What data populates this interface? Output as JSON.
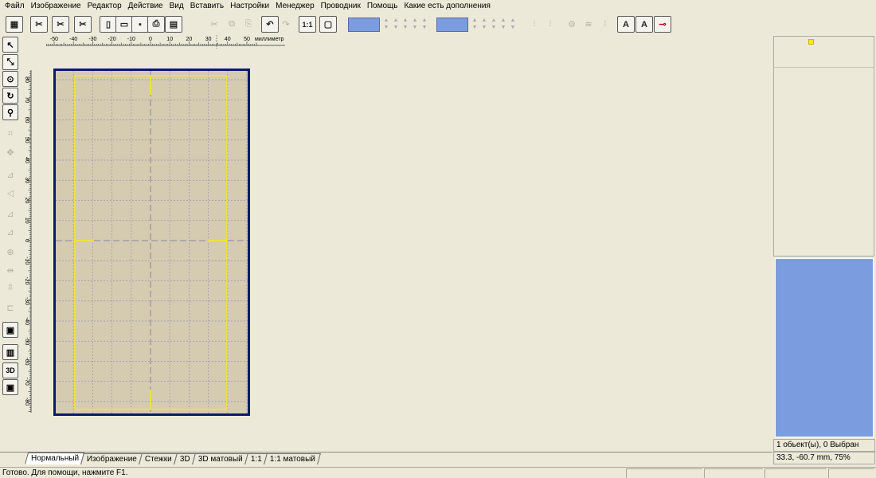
{
  "menu": [
    "Файл",
    "Изображение",
    "Редактор",
    "Действие",
    "Вид",
    "Вставить",
    "Настройки",
    "Менеджер",
    "Проводник",
    "Помощь",
    "Какие есть дополнения"
  ],
  "toolbar": {
    "buttons": [
      {
        "name": "open-design-button",
        "glyph": "▦",
        "enabled": true
      },
      {
        "name": "digitize-button",
        "glyph": "✂",
        "enabled": true
      },
      {
        "name": "digitize-photo-button",
        "glyph": "✂",
        "enabled": true
      },
      {
        "name": "digitize-cross-button",
        "glyph": "✂",
        "enabled": true
      },
      {
        "name": "new-file-button",
        "glyph": "▯",
        "enabled": true
      },
      {
        "name": "open-file-button",
        "glyph": "▭",
        "enabled": true
      },
      {
        "name": "save-button",
        "glyph": "▪",
        "enabled": true
      },
      {
        "name": "print-button",
        "glyph": "⎙",
        "enabled": true
      },
      {
        "name": "print-preview-button",
        "glyph": "▤",
        "enabled": true
      },
      {
        "name": "cut-button",
        "glyph": "✂",
        "enabled": false
      },
      {
        "name": "copy-button",
        "glyph": "⧉",
        "enabled": false
      },
      {
        "name": "paste-button",
        "glyph": "⎘",
        "enabled": false
      },
      {
        "name": "undo-button",
        "glyph": "↶",
        "enabled": true
      },
      {
        "name": "redo-button",
        "glyph": "↷",
        "enabled": false
      },
      {
        "name": "zoom-1-1-button",
        "glyph": "1:1",
        "enabled": true
      },
      {
        "name": "fit-button",
        "glyph": "▢",
        "enabled": true
      }
    ],
    "right_buttons": [
      {
        "name": "align-center-button",
        "glyph": "⫶",
        "enabled": false
      },
      {
        "name": "align-spread-button",
        "glyph": "⫶",
        "enabled": false
      },
      {
        "name": "distribute-button",
        "glyph": "⚙",
        "enabled": false
      },
      {
        "name": "wave-button",
        "glyph": "≋",
        "enabled": false
      },
      {
        "name": "column-button",
        "glyph": "⦙",
        "enabled": false
      },
      {
        "name": "text-button",
        "glyph": "A",
        "enabled": true
      },
      {
        "name": "text-path-button",
        "glyph": "A",
        "enabled": true
      },
      {
        "name": "key-button",
        "glyph": "⊸",
        "enabled": true
      }
    ]
  },
  "colors": {
    "swatch": "#7b9de0",
    "canvas": "#d4cbb0",
    "hoop_border": "#0a1a6b",
    "hoop_guide": "#ffee00"
  },
  "left_tools": [
    {
      "name": "select-tool",
      "glyph": "↖",
      "enabled": true
    },
    {
      "name": "reshape-tool",
      "glyph": "⤡",
      "enabled": true
    },
    {
      "name": "lasso-tool",
      "glyph": "⊙",
      "enabled": true
    },
    {
      "name": "rotate-tool",
      "glyph": "↻",
      "enabled": true
    },
    {
      "name": "zoom-tool",
      "glyph": "⚲",
      "enabled": true
    },
    {
      "name": "resize-tool",
      "glyph": "⌗",
      "enabled": false
    },
    {
      "name": "move-tool",
      "glyph": "✥",
      "enabled": false
    },
    {
      "name": "mirror-h-tool",
      "glyph": "⊿",
      "enabled": false
    },
    {
      "name": "mirror-v-tool",
      "glyph": "◁",
      "enabled": false
    },
    {
      "name": "skew-tool",
      "glyph": "⊿",
      "enabled": false
    },
    {
      "name": "skew-v-tool",
      "glyph": "⊿",
      "enabled": false
    },
    {
      "name": "center-tool",
      "glyph": "⊕",
      "enabled": false
    },
    {
      "name": "align-h-tool",
      "glyph": "⇹",
      "enabled": false
    },
    {
      "name": "align-v-tool",
      "glyph": "⇳",
      "enabled": false
    },
    {
      "name": "order-tool",
      "glyph": "⊏",
      "enabled": false
    },
    {
      "name": "hoop-tool",
      "glyph": "▣",
      "enabled": true
    },
    {
      "name": "view-2d-tool",
      "glyph": "▥",
      "enabled": true
    },
    {
      "name": "view-3d-tool",
      "glyph": "3D",
      "enabled": true
    },
    {
      "name": "photo-tool",
      "glyph": "▣",
      "enabled": true
    }
  ],
  "ruler": {
    "unit": "миллиметр",
    "h_labels": [
      "-50",
      "-40",
      "-30",
      "-20",
      "-10",
      "0",
      "10",
      "20",
      "30",
      "40",
      "50"
    ],
    "v_labels": [
      "80",
      "70",
      "60",
      "50",
      "40",
      "30",
      "20",
      "10",
      "0",
      "-10",
      "-20",
      "-30",
      "-40",
      "-50",
      "-60",
      "-70",
      "-80"
    ]
  },
  "tabs": [
    "Нормальный",
    "Изображение",
    "Стежки",
    "3D",
    "3D матовый",
    "1:1",
    "1:1 матовый"
  ],
  "active_tab": "Нормальный",
  "info": {
    "selection": "1 обьект(ы), 0 Выбран",
    "coords": "33.3, -60.7 mm, 75%"
  },
  "status": {
    "text": "Готово. Для помощи, нажмите F1."
  }
}
